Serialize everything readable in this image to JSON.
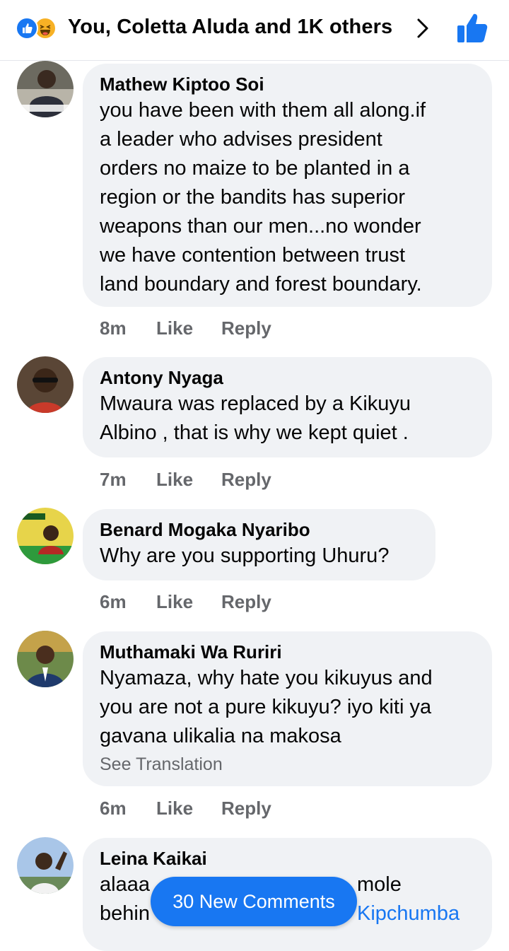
{
  "header": {
    "reactions_summary": "You, Coletta Aluda and 1K others",
    "reaction_icons": [
      "like-icon",
      "haha-icon"
    ],
    "accent_color": "#1877f2"
  },
  "comments": [
    {
      "author": "Mathew Kiptoo Soi",
      "lines": [
        "you have been with them all along.if",
        "a leader who advises president",
        "orders no maize to be planted in a",
        "region or the bandits has superior",
        "weapons than our men...no wonder",
        "we have contention between trust",
        "land boundary and forest boundary."
      ],
      "time": "8m",
      "like": "Like",
      "reply": "Reply"
    },
    {
      "author": "Antony Nyaga",
      "lines": [
        "Mwaura was replaced by a Kikuyu",
        "Albino , that is why we kept quiet ."
      ],
      "time": "7m",
      "like": "Like",
      "reply": "Reply"
    },
    {
      "author": "Benard Mogaka Nyaribo",
      "lines": [
        "Why are you supporting Uhuru?"
      ],
      "time": "6m",
      "like": "Like",
      "reply": "Reply"
    },
    {
      "author": "Muthamaki Wa Ruriri",
      "lines": [
        "Nyamaza, why hate you kikuyus and",
        "you are not a pure kikuyu? iyo kiti ya",
        "gavana ulikalia na makosa"
      ],
      "see_translation": "See Translation",
      "time": "6m",
      "like": "Like",
      "reply": "Reply"
    },
    {
      "author": "Leina Kaikai",
      "line1_start": "alaaa",
      "line1_end": "mole",
      "line2_start": "behin",
      "mention": "Kipchumba"
    }
  ],
  "new_comments_button": "30 New Comments"
}
